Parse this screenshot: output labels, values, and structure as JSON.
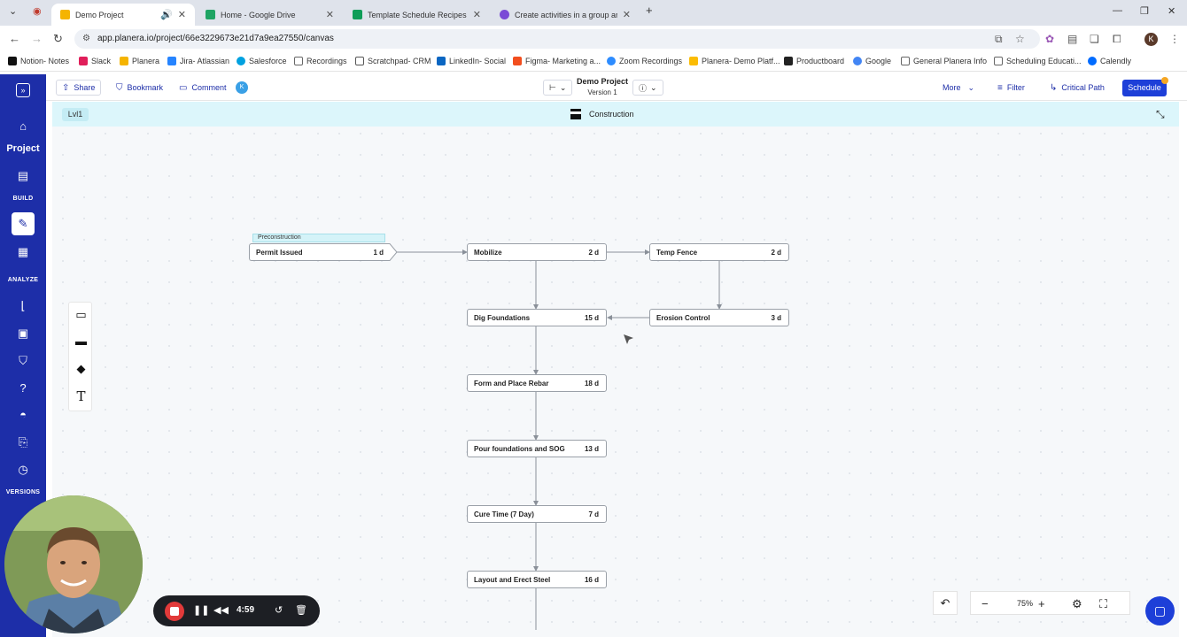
{
  "browser": {
    "tabs": [
      {
        "title": "Demo Project",
        "color": "#f5b400"
      },
      {
        "title": "Home - Google Drive",
        "color": "#1fa463"
      },
      {
        "title": "Template Schedule Recipes - G",
        "color": "#0f9d58"
      },
      {
        "title": "Create activities in a group and",
        "color": "#7b4bd6"
      }
    ],
    "new_tab": "+",
    "url": "app.planera.io/project/66e3229673e21d7a9ea27550/canvas",
    "profile_initial": "K",
    "bookmarks": [
      {
        "label": "Notion- Notes",
        "color": "#111"
      },
      {
        "label": "Slack",
        "color": "#e01e5a"
      },
      {
        "label": "Planera",
        "color": "#f5b400"
      },
      {
        "label": "Jira- Atlassian",
        "color": "#2684ff"
      },
      {
        "label": "Salesforce",
        "color": "#00a1e0"
      },
      {
        "label": "Recordings",
        "color": "#666"
      },
      {
        "label": "Scratchpad- CRM",
        "color": "#555"
      },
      {
        "label": "LinkedIn- Social",
        "color": "#0a66c2"
      },
      {
        "label": "Figma- Marketing a...",
        "color": "#f24e1e"
      },
      {
        "label": "Zoom Recordings",
        "color": "#2d8cff"
      },
      {
        "label": "Planera- Demo Platf...",
        "color": "#fbbc04"
      },
      {
        "label": "Productboard",
        "color": "#222"
      },
      {
        "label": "Google",
        "color": "#4285f4"
      },
      {
        "label": "General Planera Info",
        "color": "#666"
      },
      {
        "label": "Scheduling Educati...",
        "color": "#666"
      },
      {
        "label": "Calendly",
        "color": "#006bff"
      }
    ]
  },
  "sidebar": {
    "project_label": "Project",
    "build_label": "BUILD",
    "analyze_label": "ANALYZE",
    "versions_label": "VERSIONS"
  },
  "toolbar": {
    "share": "Share",
    "bookmark": "Bookmark",
    "comment": "Comment",
    "user_initial": "K",
    "project_title": "Demo Project",
    "version": "Version 1",
    "more": "More",
    "filter": "Filter",
    "critical_path": "Critical Path",
    "schedule": "Schedule"
  },
  "canvas": {
    "level": "Lvl1",
    "group": "Construction",
    "tag": "Preconstruction",
    "nodes": [
      {
        "name": "Permit Issued",
        "duration": "1 d"
      },
      {
        "name": "Mobilize",
        "duration": "2 d"
      },
      {
        "name": "Temp Fence",
        "duration": "2 d"
      },
      {
        "name": "Dig Foundations",
        "duration": "15 d"
      },
      {
        "name": "Erosion Control",
        "duration": "3 d"
      },
      {
        "name": "Form and Place Rebar",
        "duration": "18 d"
      },
      {
        "name": "Pour foundations and SOG",
        "duration": "13 d"
      },
      {
        "name": "Cure Time (7 Day)",
        "duration": "7 d"
      },
      {
        "name": "Layout and Erect Steel",
        "duration": "16 d"
      }
    ]
  },
  "zoom": {
    "level": "75%"
  },
  "recorder": {
    "timer": "4:59"
  }
}
